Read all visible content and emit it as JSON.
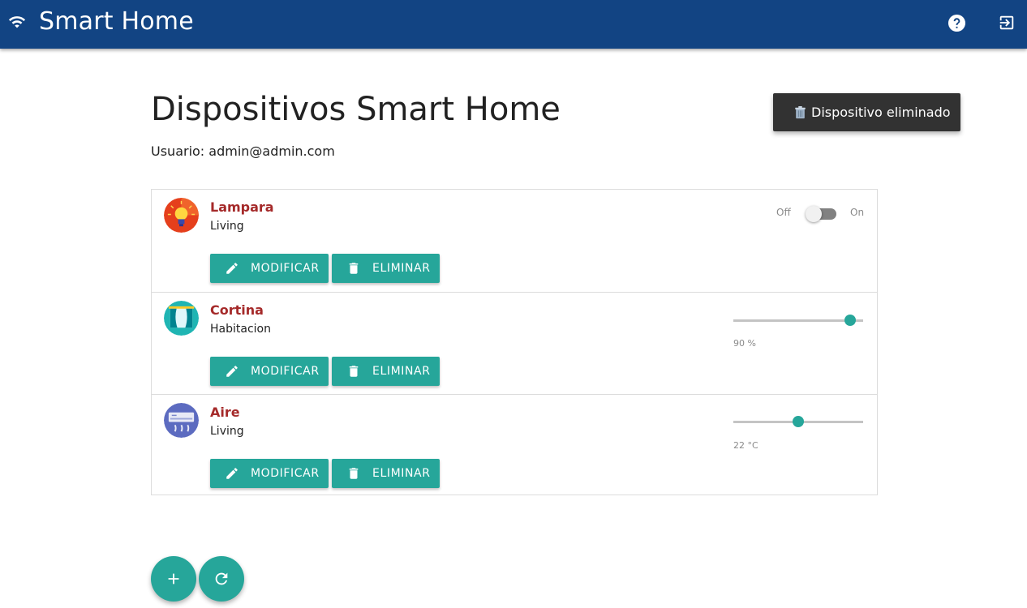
{
  "app": {
    "title": "Smart Home"
  },
  "page": {
    "title": "Dispositivos Smart Home",
    "user_line": "Usuario: admin@admin.com"
  },
  "toast": {
    "text": "Dispositivo eliminado"
  },
  "colors": {
    "appbar": "#124483",
    "accent": "#26a69a",
    "device_name": "#a52a2a",
    "toast_bg": "#323232"
  },
  "icons": {
    "appbar_left": "wifi-icon",
    "help": "help-circle-icon",
    "logout": "logout-icon",
    "modify": "pencil-icon",
    "delete": "trash-icon",
    "add": "plus-icon",
    "refresh": "refresh-icon"
  },
  "devices": [
    {
      "name": "Lampara",
      "room": "Living",
      "icon": "lamp-icon",
      "control": "switch",
      "switch": {
        "off_label": "Off",
        "on_label": "On",
        "state": "off"
      },
      "modify_label": "MODIFICAR",
      "delete_label": "ELIMINAR"
    },
    {
      "name": "Cortina",
      "room": "Habitacion",
      "icon": "curtain-icon",
      "control": "slider",
      "slider": {
        "value": 90,
        "max": 100,
        "label": "90 %"
      },
      "modify_label": "MODIFICAR",
      "delete_label": "ELIMINAR"
    },
    {
      "name": "Aire",
      "room": "Living",
      "icon": "air-conditioner-icon",
      "control": "slider",
      "slider": {
        "value": 0.5,
        "label": "22 °C"
      },
      "modify_label": "MODIFICAR",
      "delete_label": "ELIMINAR"
    }
  ]
}
